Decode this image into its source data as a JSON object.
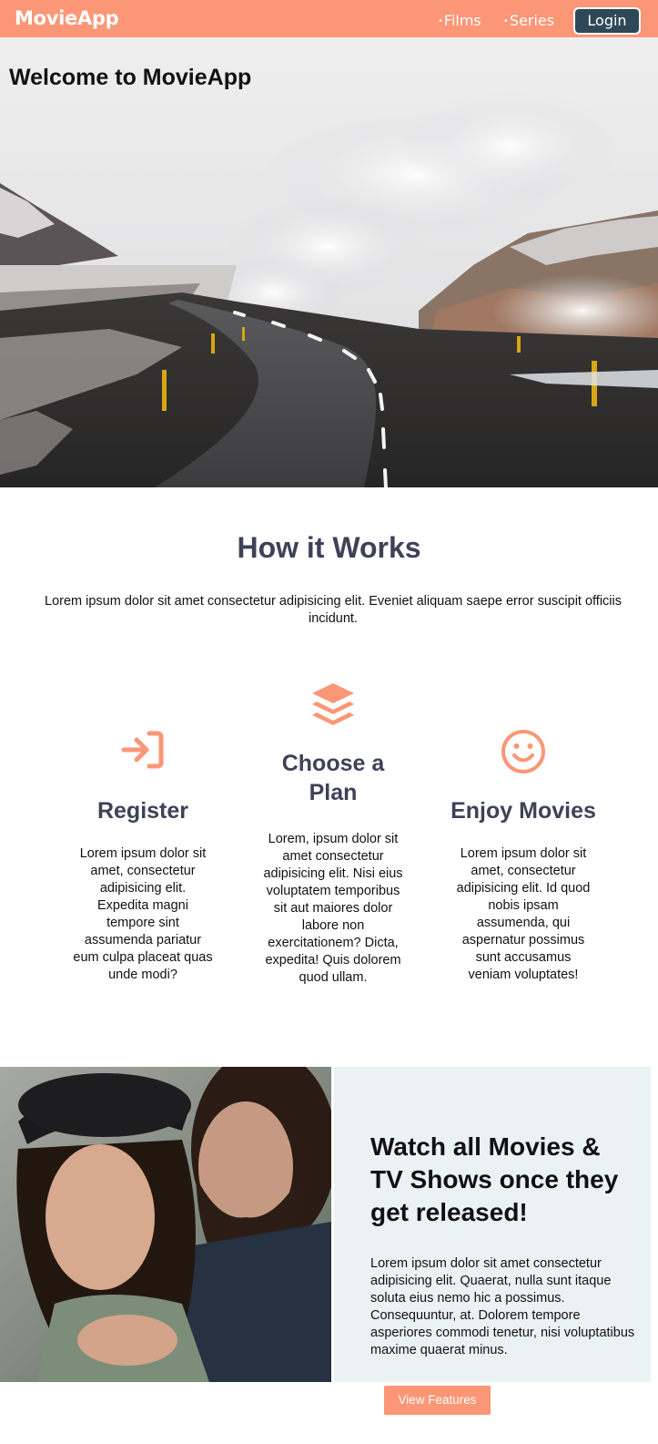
{
  "nav": {
    "brand": "MovieApp",
    "links": [
      {
        "bullet": "•",
        "label": "Films"
      },
      {
        "bullet": "•",
        "label": "Series"
      }
    ],
    "login_label": "Login",
    "colors": {
      "bar": "#fb9677",
      "login": "#2f4858"
    }
  },
  "hero": {
    "title": "Welcome to MovieApp",
    "image": "mountain-road-landscape"
  },
  "how": {
    "title": "How it Works",
    "subtitle": "Lorem ipsum dolor sit amet consectetur adipisicing elit. Eveniet aliquam saepe error suscipit officiis incidunt.",
    "steps": [
      {
        "icon": "sign-in-icon",
        "title": "Register",
        "text": "Lorem ipsum dolor sit amet, consectetur adipisicing elit. Expedita magni tempore sint assumenda pariatur eum culpa placeat quas unde modi?"
      },
      {
        "icon": "layers-icon",
        "title": "Choose a Plan",
        "text": "Lorem, ipsum dolor sit amet consectetur adipisicing elit. Nisi eius voluptatem temporibus sit aut maiores dolor labore non exercitationem? Dicta, expedita! Quis dolorem quod ullam."
      },
      {
        "icon": "smile-icon",
        "title": "Enjoy Movies",
        "text": "Lorem ipsum dolor sit amet, consectetur adipisicing elit. Id quod nobis ipsam assumenda, qui aspernatur possimus sunt accusamus veniam voluptates!"
      }
    ]
  },
  "feature": {
    "image": "couple-photo",
    "title": "Watch all Movies & TV Shows once they get released!",
    "text": "Lorem ipsum dolor sit amet consectetur adipisicing elit. Quaerat, nulla sunt itaque soluta eius nemo hic a possimus. Consequuntur, at. Dolorem tempore asperiores commodi tenetur, nisi voluptatibus maxime quaerat minus.",
    "button_label": "View Features"
  },
  "accent_color": "#fb9677",
  "heading_color": "#3d4257"
}
